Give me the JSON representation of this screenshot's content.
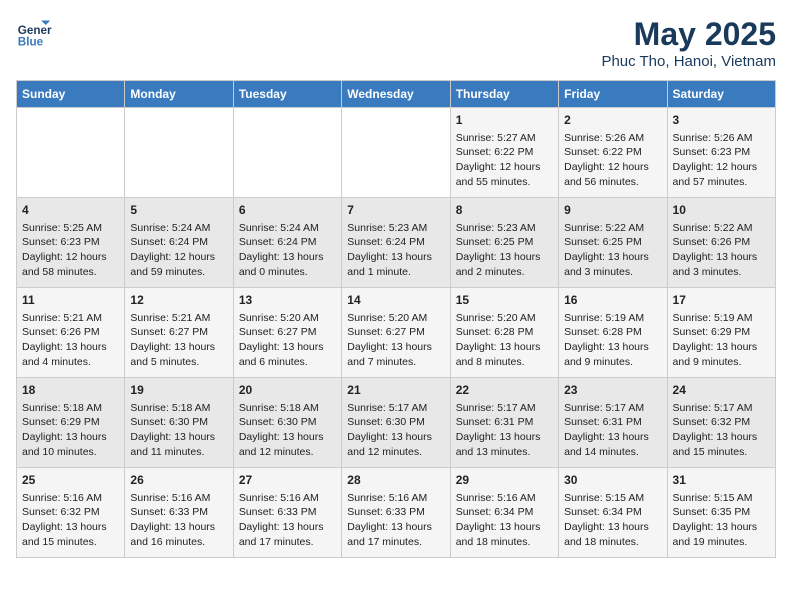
{
  "logo": {
    "line1": "General",
    "line2": "Blue"
  },
  "title": "May 2025",
  "subtitle": "Phuc Tho, Hanoi, Vietnam",
  "weekdays": [
    "Sunday",
    "Monday",
    "Tuesday",
    "Wednesday",
    "Thursday",
    "Friday",
    "Saturday"
  ],
  "weeks": [
    [
      {
        "day": "",
        "info": ""
      },
      {
        "day": "",
        "info": ""
      },
      {
        "day": "",
        "info": ""
      },
      {
        "day": "",
        "info": ""
      },
      {
        "day": "1",
        "info": "Sunrise: 5:27 AM\nSunset: 6:22 PM\nDaylight: 12 hours\nand 55 minutes."
      },
      {
        "day": "2",
        "info": "Sunrise: 5:26 AM\nSunset: 6:22 PM\nDaylight: 12 hours\nand 56 minutes."
      },
      {
        "day": "3",
        "info": "Sunrise: 5:26 AM\nSunset: 6:23 PM\nDaylight: 12 hours\nand 57 minutes."
      }
    ],
    [
      {
        "day": "4",
        "info": "Sunrise: 5:25 AM\nSunset: 6:23 PM\nDaylight: 12 hours\nand 58 minutes."
      },
      {
        "day": "5",
        "info": "Sunrise: 5:24 AM\nSunset: 6:24 PM\nDaylight: 12 hours\nand 59 minutes."
      },
      {
        "day": "6",
        "info": "Sunrise: 5:24 AM\nSunset: 6:24 PM\nDaylight: 13 hours\nand 0 minutes."
      },
      {
        "day": "7",
        "info": "Sunrise: 5:23 AM\nSunset: 6:24 PM\nDaylight: 13 hours\nand 1 minute."
      },
      {
        "day": "8",
        "info": "Sunrise: 5:23 AM\nSunset: 6:25 PM\nDaylight: 13 hours\nand 2 minutes."
      },
      {
        "day": "9",
        "info": "Sunrise: 5:22 AM\nSunset: 6:25 PM\nDaylight: 13 hours\nand 3 minutes."
      },
      {
        "day": "10",
        "info": "Sunrise: 5:22 AM\nSunset: 6:26 PM\nDaylight: 13 hours\nand 3 minutes."
      }
    ],
    [
      {
        "day": "11",
        "info": "Sunrise: 5:21 AM\nSunset: 6:26 PM\nDaylight: 13 hours\nand 4 minutes."
      },
      {
        "day": "12",
        "info": "Sunrise: 5:21 AM\nSunset: 6:27 PM\nDaylight: 13 hours\nand 5 minutes."
      },
      {
        "day": "13",
        "info": "Sunrise: 5:20 AM\nSunset: 6:27 PM\nDaylight: 13 hours\nand 6 minutes."
      },
      {
        "day": "14",
        "info": "Sunrise: 5:20 AM\nSunset: 6:27 PM\nDaylight: 13 hours\nand 7 minutes."
      },
      {
        "day": "15",
        "info": "Sunrise: 5:20 AM\nSunset: 6:28 PM\nDaylight: 13 hours\nand 8 minutes."
      },
      {
        "day": "16",
        "info": "Sunrise: 5:19 AM\nSunset: 6:28 PM\nDaylight: 13 hours\nand 9 minutes."
      },
      {
        "day": "17",
        "info": "Sunrise: 5:19 AM\nSunset: 6:29 PM\nDaylight: 13 hours\nand 9 minutes."
      }
    ],
    [
      {
        "day": "18",
        "info": "Sunrise: 5:18 AM\nSunset: 6:29 PM\nDaylight: 13 hours\nand 10 minutes."
      },
      {
        "day": "19",
        "info": "Sunrise: 5:18 AM\nSunset: 6:30 PM\nDaylight: 13 hours\nand 11 minutes."
      },
      {
        "day": "20",
        "info": "Sunrise: 5:18 AM\nSunset: 6:30 PM\nDaylight: 13 hours\nand 12 minutes."
      },
      {
        "day": "21",
        "info": "Sunrise: 5:17 AM\nSunset: 6:30 PM\nDaylight: 13 hours\nand 12 minutes."
      },
      {
        "day": "22",
        "info": "Sunrise: 5:17 AM\nSunset: 6:31 PM\nDaylight: 13 hours\nand 13 minutes."
      },
      {
        "day": "23",
        "info": "Sunrise: 5:17 AM\nSunset: 6:31 PM\nDaylight: 13 hours\nand 14 minutes."
      },
      {
        "day": "24",
        "info": "Sunrise: 5:17 AM\nSunset: 6:32 PM\nDaylight: 13 hours\nand 15 minutes."
      }
    ],
    [
      {
        "day": "25",
        "info": "Sunrise: 5:16 AM\nSunset: 6:32 PM\nDaylight: 13 hours\nand 15 minutes."
      },
      {
        "day": "26",
        "info": "Sunrise: 5:16 AM\nSunset: 6:33 PM\nDaylight: 13 hours\nand 16 minutes."
      },
      {
        "day": "27",
        "info": "Sunrise: 5:16 AM\nSunset: 6:33 PM\nDaylight: 13 hours\nand 17 minutes."
      },
      {
        "day": "28",
        "info": "Sunrise: 5:16 AM\nSunset: 6:33 PM\nDaylight: 13 hours\nand 17 minutes."
      },
      {
        "day": "29",
        "info": "Sunrise: 5:16 AM\nSunset: 6:34 PM\nDaylight: 13 hours\nand 18 minutes."
      },
      {
        "day": "30",
        "info": "Sunrise: 5:15 AM\nSunset: 6:34 PM\nDaylight: 13 hours\nand 18 minutes."
      },
      {
        "day": "31",
        "info": "Sunrise: 5:15 AM\nSunset: 6:35 PM\nDaylight: 13 hours\nand 19 minutes."
      }
    ]
  ]
}
